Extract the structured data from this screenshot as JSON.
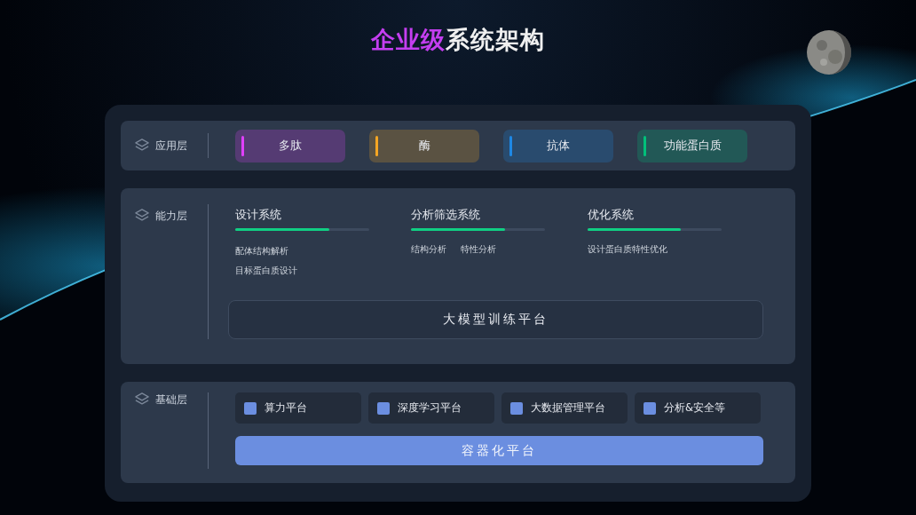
{
  "title": {
    "highlight": "企业级",
    "rest": "系统架构"
  },
  "layers": [
    {
      "kind": "tags",
      "label": "应用层",
      "tags": [
        {
          "label": "多肽",
          "color": "#e040fb"
        },
        {
          "label": "酶",
          "color": "#f5a623"
        },
        {
          "label": "抗体",
          "color": "#1e88e5"
        },
        {
          "label": "功能蛋白质",
          "color": "#00c07a"
        }
      ]
    },
    {
      "kind": "systems",
      "label": "能力层",
      "systems": [
        {
          "name": "设计系统",
          "level": 0.7,
          "kind": "stacked",
          "items": [
            "配体结构解析",
            "目标蛋白质设计"
          ]
        },
        {
          "name": "分析筛选系统",
          "level": 0.7,
          "kind": "inline",
          "items": [
            "结构分析",
            "特性分析"
          ]
        },
        {
          "name": "优化系统",
          "level": 0.7,
          "kind": "inline",
          "items": [
            "设计蛋白质特性优化"
          ]
        }
      ],
      "platform": "大模型训练平台"
    },
    {
      "kind": "platforms",
      "label": "基础层",
      "platforms": [
        "算力平台",
        "深度学习平台",
        "大数据管理平台",
        "分析&安全等"
      ],
      "platform": "容器化平台"
    }
  ]
}
